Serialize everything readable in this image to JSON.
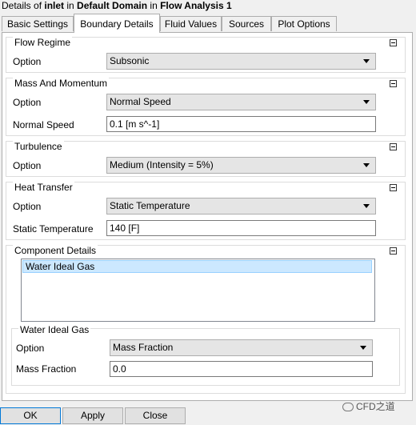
{
  "title": {
    "prefix": "Details of ",
    "object": "inlet",
    "mid1": " in ",
    "domain": "Default Domain",
    "mid2": " in ",
    "analysis": "Flow Analysis 1"
  },
  "tabs": [
    {
      "label": "Basic Settings",
      "active": false
    },
    {
      "label": "Boundary Details",
      "active": true
    },
    {
      "label": "Fluid Values",
      "active": false
    },
    {
      "label": "Sources",
      "active": false
    },
    {
      "label": "Plot Options",
      "active": false
    }
  ],
  "flow_regime": {
    "title": "Flow Regime",
    "option_label": "Option",
    "option_value": "Subsonic"
  },
  "mass_momentum": {
    "title": "Mass And Momentum",
    "option_label": "Option",
    "option_value": "Normal Speed",
    "speed_label": "Normal Speed",
    "speed_value": "0.1 [m s^-1]"
  },
  "turbulence": {
    "title": "Turbulence",
    "option_label": "Option",
    "option_value": "Medium (Intensity = 5%)"
  },
  "heat_transfer": {
    "title": "Heat Transfer",
    "option_label": "Option",
    "option_value": "Static Temperature",
    "temp_label": "Static Temperature",
    "temp_value": "140 [F]"
  },
  "component_details": {
    "title": "Component Details",
    "items": [
      "Water Ideal Gas"
    ],
    "selected": "Water Ideal Gas",
    "sub": {
      "title": "Water Ideal Gas",
      "option_label": "Option",
      "option_value": "Mass Fraction",
      "fraction_label": "Mass Fraction",
      "fraction_value": "0.0"
    }
  },
  "buttons": {
    "ok": "OK",
    "apply": "Apply",
    "close": "Close"
  },
  "watermark": "CFD之道"
}
